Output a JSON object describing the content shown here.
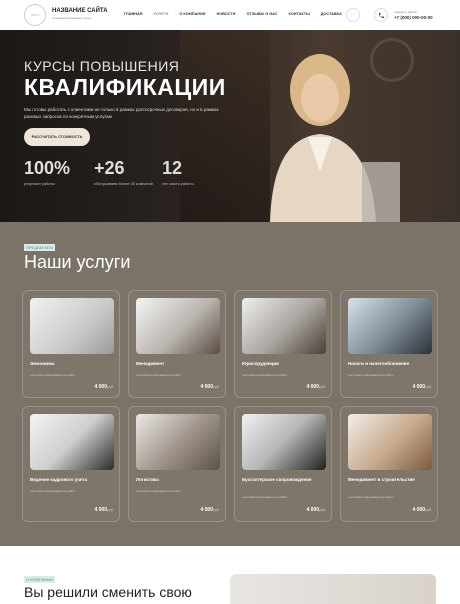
{
  "header": {
    "logo_text": "ЛОГО",
    "site_name": "НАЗВАНИЕ САЙТА",
    "site_sub": "Специализированные курсы",
    "nav": [
      "ГЛАВНАЯ",
      "УСЛУГИ",
      "О КОМПАНИИ",
      "НОВОСТИ",
      "ОТЗЫВЫ О НАС",
      "КОНТАКТЫ",
      "ДОСТАВКА"
    ],
    "more": "···",
    "phone_icon": "phone-icon",
    "phone_label": "закажите звонок",
    "phone_number": "+7 (000) 000-00-00"
  },
  "hero": {
    "title_line1": "КУРСЫ ПОВЫШЕНИЯ",
    "title_line2": "КВАЛИФИКАЦИИ",
    "description": "Мы готовы работать с клиентами не только в рамках долгосрочных договоров, но и в рамках разовых запросов по конкретным услугам",
    "button": "РАССЧИТАТЬ СТОИМОСТЬ",
    "stats": [
      {
        "num": "100%",
        "label": "результат работы"
      },
      {
        "num": "+26",
        "label": "обслуживаем более 25 компаний"
      },
      {
        "num": "12",
        "label": "лет опыта работы"
      }
    ]
  },
  "services": {
    "tag": "ПРЕДЛАГАЕМ",
    "title": "Наши услуги",
    "cards": [
      {
        "title": "Экономика",
        "sub": "текстовая информация на сайте",
        "price": "4 000",
        "unit": "руб."
      },
      {
        "title": "Менеджмент",
        "sub": "текстовая информация на сайте",
        "price": "4 000",
        "unit": "руб."
      },
      {
        "title": "Юриспруденция",
        "sub": "текстовая информация на сайте",
        "price": "4 000",
        "unit": "руб."
      },
      {
        "title": "Налоги и налогообложение",
        "sub": "текстовая информация на сайте",
        "price": "4 000",
        "unit": "руб."
      },
      {
        "title": "Ведение кадрового учета",
        "sub": "текстовая информация на сайте",
        "price": "4 000",
        "unit": "руб."
      },
      {
        "title": "Логистика",
        "sub": "текстовая информация на сайте",
        "price": "4 000",
        "unit": "руб."
      },
      {
        "title": "Бухгалтерское сопровождение",
        "sub": "текстовая информация на сайте",
        "price": "4 000",
        "unit": "руб."
      },
      {
        "title": "Менеджмент в строительстве",
        "sub": "текстовая информация на сайте",
        "price": "4 000",
        "unit": "руб."
      }
    ]
  },
  "about": {
    "tag": "О КОМПАНИИ",
    "title": "Вы решили сменить свою"
  },
  "colors": {
    "accent": "#efe5da",
    "services_bg": "#7b7368",
    "tag_bg": "#d9ece8"
  }
}
